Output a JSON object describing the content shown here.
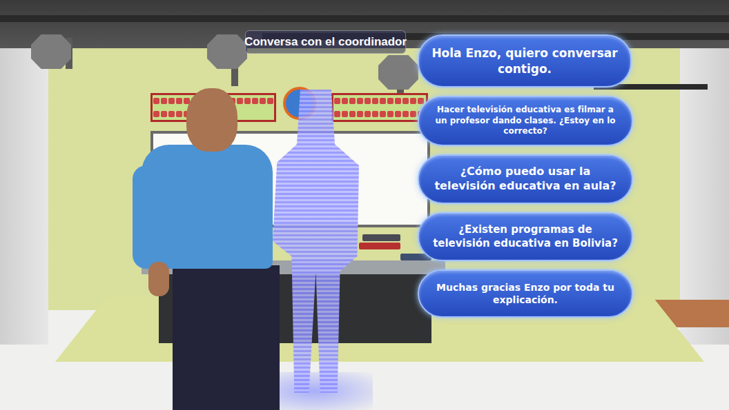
{
  "title": "Conversa con el coordinador",
  "options": [
    {
      "text": "Hola Enzo, quiero conversar contigo."
    },
    {
      "text": "Hacer televisión educativa es filmar a un profesor dando clases. ¿Estoy en lo correcto?"
    },
    {
      "text": "¿Cómo puedo usar la televisión educativa en aula?"
    },
    {
      "text": "¿Existen programas de televisión educativa en Bolivia?"
    },
    {
      "text": "Muchas gracias Enzo por toda tu explicación."
    }
  ]
}
